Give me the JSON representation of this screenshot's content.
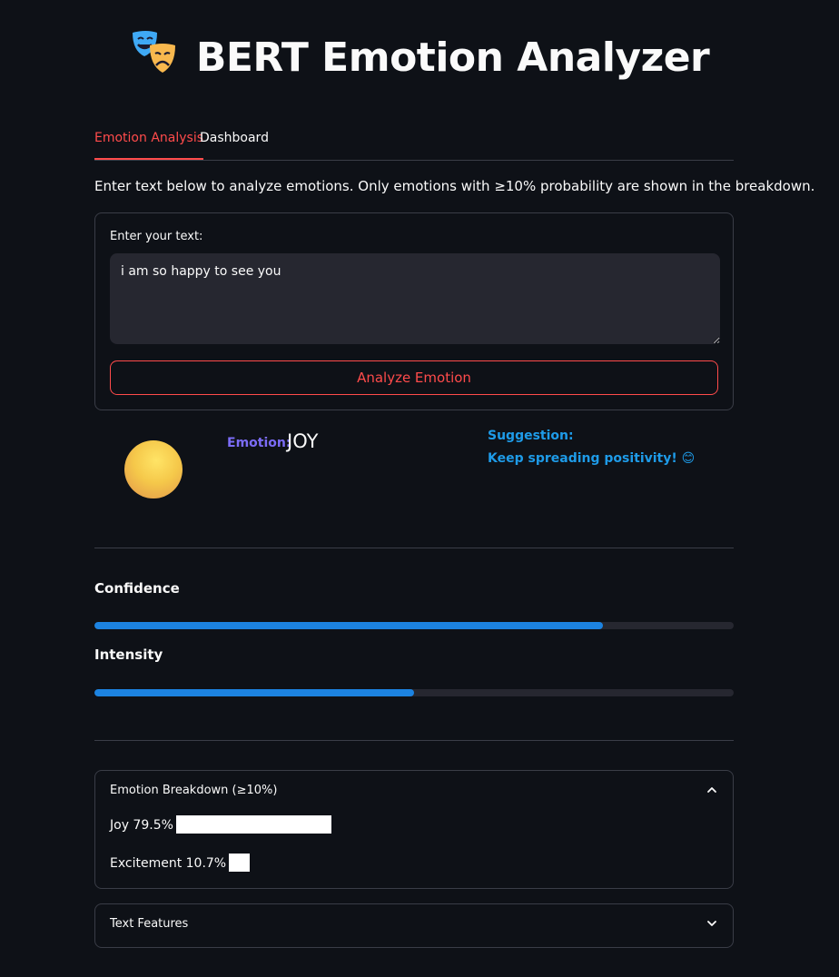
{
  "app": {
    "title": "BERT Emotion Analyzer",
    "logo_icon": "theater-masks-icon"
  },
  "tabs": [
    {
      "label": "Emotion Analysis",
      "active": true
    },
    {
      "label": "Dashboard",
      "active": false
    }
  ],
  "intro_text": "Enter text below to analyze emotions. Only emotions with ≥10% probability are shown in the breakdown.",
  "form": {
    "label": "Enter your text:",
    "value": "i am so happy to see you",
    "button_label": "Analyze Emotion"
  },
  "result": {
    "emotion_label": "Emotion:",
    "emotion_value": "JOY",
    "suggestion_label": "Suggestion:",
    "suggestion_text": "Keep spreading positivity! 😊"
  },
  "metrics": {
    "confidence_label": "Confidence",
    "confidence_value": 0.795,
    "intensity_label": "Intensity",
    "intensity_value": 0.5
  },
  "breakdown": {
    "title": "Emotion Breakdown (≥10%)",
    "expanded": true,
    "items": [
      {
        "label": "Joy 79.5%",
        "value": 79.5
      },
      {
        "label": "Excitement 10.7%",
        "value": 10.7
      }
    ]
  },
  "features": {
    "title": "Text Features",
    "expanded": false
  },
  "colors": {
    "background": "#0e1117",
    "accent": "#ff4b4b",
    "emotion_label": "#7b6cf6",
    "suggestion": "#1e9be8",
    "progress": "#1c83e1"
  }
}
